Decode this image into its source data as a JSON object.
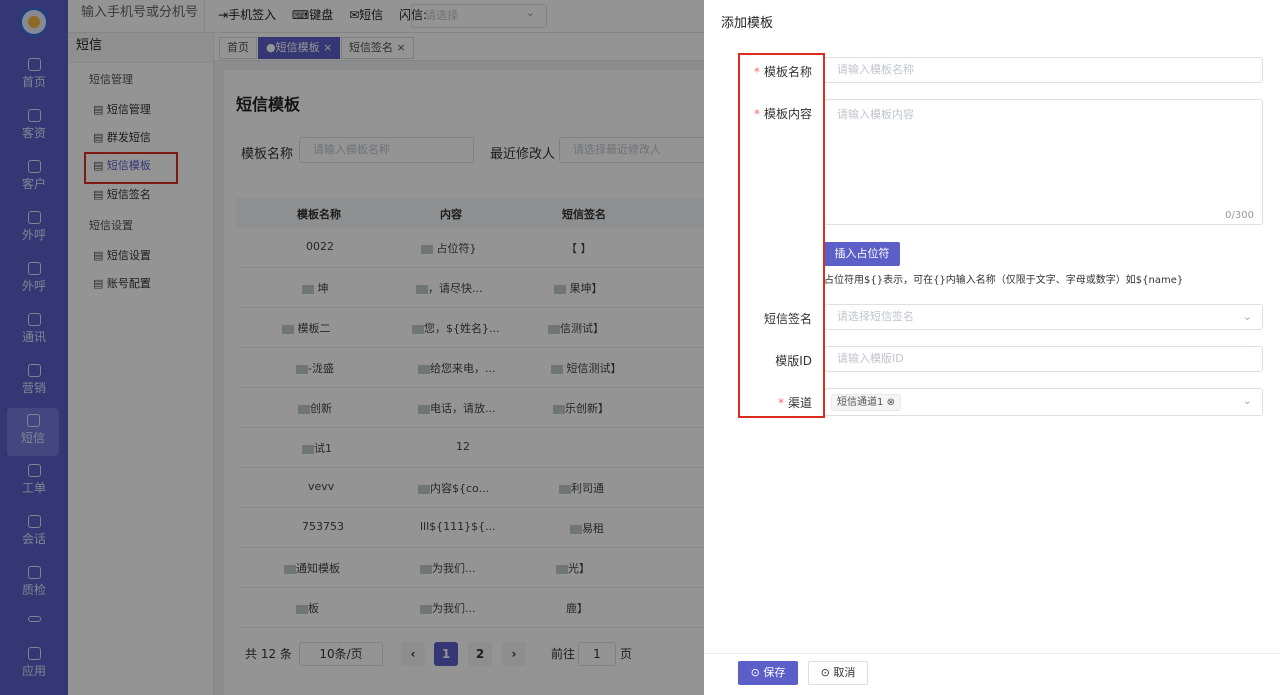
{
  "nav": {
    "items": [
      {
        "label": "首页",
        "icon": "home-icon"
      },
      {
        "label": "客资",
        "icon": "users-icon"
      },
      {
        "label": "客户",
        "icon": "user-icon"
      },
      {
        "label": "外呼",
        "icon": "phone-icon"
      },
      {
        "label": "外呼",
        "icon": "phone-out-icon"
      },
      {
        "label": "通讯",
        "icon": "contacts-icon"
      },
      {
        "label": "营销",
        "icon": "gear-icon"
      },
      {
        "label": "短信",
        "icon": "message-icon"
      },
      {
        "label": "工单",
        "icon": "clipboard-icon"
      },
      {
        "label": "会话",
        "icon": "chat-icon"
      },
      {
        "label": "质检",
        "icon": "calendar-icon"
      },
      {
        "label": "",
        "icon": "divider-icon"
      },
      {
        "label": "应用",
        "icon": "app-icon"
      }
    ]
  },
  "header": {
    "search_placeholder": "输入手机号或分机号",
    "checkin": "手机签入",
    "keyboard": "键盘",
    "sms": "短信",
    "flash_label": "闪信:",
    "flash_placeholder": "请选择"
  },
  "side": {
    "title": "短信",
    "group1": "短信管理",
    "items1": [
      "短信管理",
      "群发短信",
      "短信模板",
      "短信签名"
    ],
    "group2": "短信设置",
    "items2": [
      "短信设置",
      "账号配置"
    ]
  },
  "tabs": [
    {
      "label": "首页"
    },
    {
      "label": "●短信模板 ×"
    },
    {
      "label": "短信签名 ×"
    }
  ],
  "page": {
    "title": "短信模板",
    "filter_name_label": "模板名称",
    "filter_name_placeholder": "请输入模板名称",
    "filter_modifier_label": "最近修改人",
    "filter_modifier_placeholder": "请选择最近修改人"
  },
  "table": {
    "headers": [
      "模板名称",
      "内容",
      "短信签名"
    ],
    "rows": [
      [
        "0022",
        "占位符}",
        "【 】"
      ],
      [
        "坤",
        "，请尽快...",
        "果坤】"
      ],
      [
        "模板二",
        "您，${姓名}...",
        "信测试】"
      ],
      [
        "-泷盛",
        "给您来电，...",
        "短信测试】"
      ],
      [
        "创新",
        "电话，请放...",
        "乐创新】"
      ],
      [
        "试1",
        "12",
        ""
      ],
      [
        "vevv",
        "内容${co...",
        "利司通"
      ],
      [
        "753753",
        "lll${111}${...",
        "易租"
      ],
      [
        "通知模板",
        "为我们...",
        "光】"
      ],
      [
        "板",
        "为我们...",
        "鹿】"
      ]
    ]
  },
  "pagination": {
    "total": "共 12 条",
    "page_size": "10条/页",
    "prev": "‹",
    "pages": [
      "1",
      "2"
    ],
    "next": "›",
    "goto_label": "前往",
    "goto_value": "1",
    "goto_suffix": "页"
  },
  "drawer": {
    "title": "添加模板",
    "name_label": "模板名称",
    "name_placeholder": "请输入模板名称",
    "content_label": "模板内容",
    "content_placeholder": "请输入模板内容",
    "content_counter": "0/300",
    "insert_button": "插入占位符",
    "hint": "占位符用${}表示，可在{}内输入名称（仅限于文字、字母或数字）如${name}",
    "sign_label": "短信签名",
    "sign_placeholder": "请选择短信签名",
    "tplid_label": "模版ID",
    "tplid_placeholder": "请输入模版ID",
    "channel_label": "渠道",
    "channel_chip": "短信通道1",
    "save": "保存",
    "cancel": "取消"
  },
  "colors": {
    "primary": "#5b5fc7",
    "required": "#f56c6c",
    "highlight_box": "#d92d20"
  }
}
